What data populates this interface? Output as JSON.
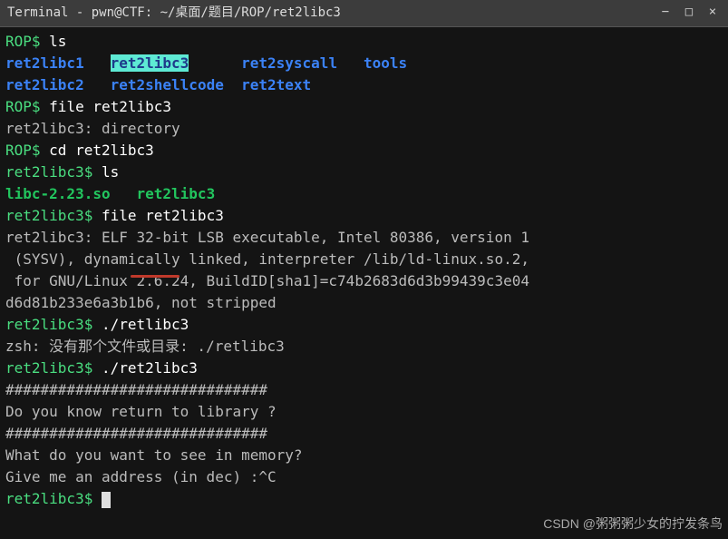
{
  "titlebar": "Terminal - pwn@CTF: ~/桌面/题目/ROP/ret2libc3",
  "lines": {
    "l1_prompt": "ROP$ ",
    "l1_cmd": "ls",
    "l2_a": "ret2libc1",
    "l2_b": "ret2libc3",
    "l2_c": "ret2syscall",
    "l2_d": "tools",
    "l3_a": "ret2libc2",
    "l3_b": "ret2shellcode",
    "l3_c": "ret2text",
    "l4_prompt": "ROP$ ",
    "l4_cmd": "file ret2libc3",
    "l5": "ret2libc3: directory",
    "l6_prompt": "ROP$ ",
    "l6_cmd": "cd ret2libc3",
    "l7_prompt": "ret2libc3$ ",
    "l7_cmd": "ls",
    "l8_a": "libc-2.23.so",
    "l8_b": "ret2libc3",
    "l9_prompt": "ret2libc3$ ",
    "l9_cmd": "file ret2libc3",
    "l10": "ret2libc3: ELF 32-bit LSB executable, Intel 80386, version 1",
    "l11": " (SYSV), dynamically linked, interpreter /lib/ld-linux.so.2,",
    "l12": " for GNU/Linux 2.6.24, BuildID[sha1]=c74b2683d6d3b99439c3e04",
    "l13": "d6d81b233e6a3b1b6, not stripped",
    "l14_prompt": "ret2libc3$ ",
    "l14_cmd": "./retlibc3",
    "l15": "zsh: 没有那个文件或目录: ./retlibc3",
    "l16_prompt": "ret2libc3$ ",
    "l16_cmd": "./ret2libc3",
    "l17": "##############################",
    "l18": "Do you know return to library ?",
    "l19": "##############################",
    "l20": "What do you want to see in memory?",
    "l21": "Give me an address (in dec) :^C",
    "l22_prompt": "ret2libc3$ "
  },
  "watermark": "CSDN @粥粥粥少女的拧发条鸟",
  "bg_labels": {
    "ret2libc1": "ret2libc1",
    "ret2libc2": "ret2libc2"
  }
}
